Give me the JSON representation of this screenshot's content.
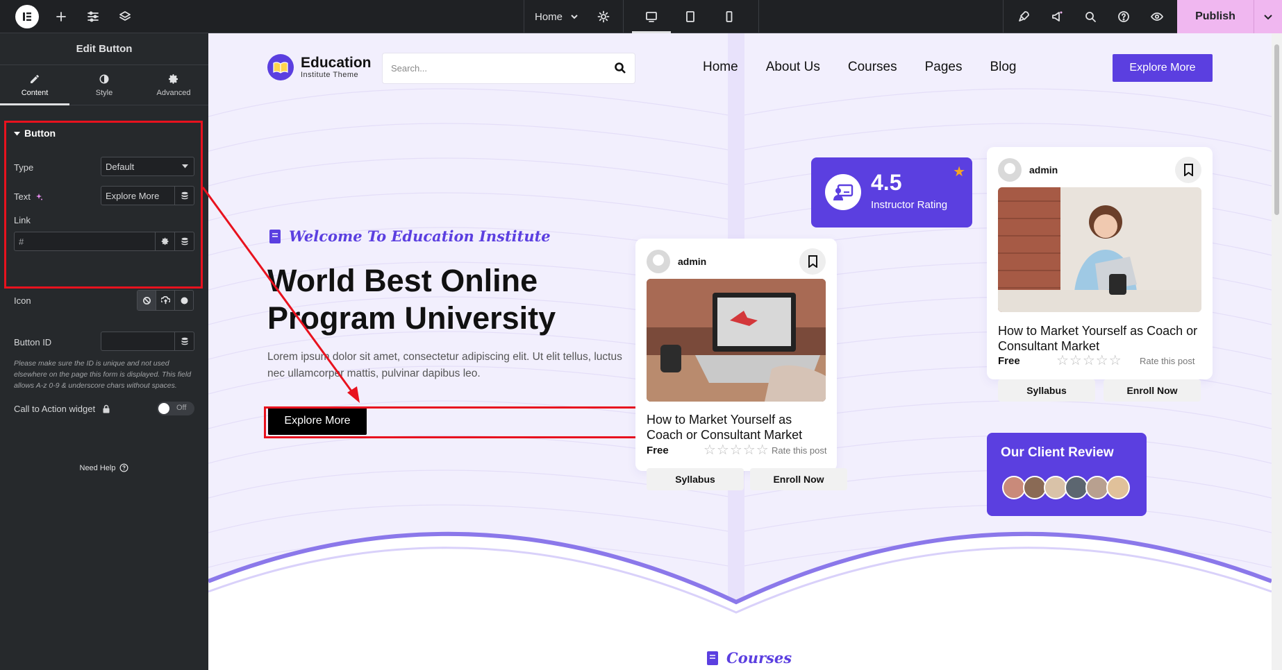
{
  "topbar": {
    "page_name": "Home",
    "publish_label": "Publish"
  },
  "panel": {
    "title": "Edit Button",
    "tabs": [
      {
        "label": "Content"
      },
      {
        "label": "Style"
      },
      {
        "label": "Advanced"
      }
    ],
    "section_title": "Button",
    "type_label": "Type",
    "type_value": "Default",
    "text_label": "Text",
    "text_value": "Explore More",
    "link_label": "Link",
    "link_value": "#",
    "icon_label": "Icon",
    "button_id_label": "Button ID",
    "button_id_value": "",
    "button_id_help": "Please make sure the ID is unique and not used elsewhere on the page this form is displayed. This field allows A-z  0-9 & underscore chars without spaces.",
    "cta_label": "Call to Action widget",
    "toggle_state": "Off",
    "need_help": "Need Help"
  },
  "site": {
    "logo_name": "Education",
    "logo_tagline": "Institute Theme",
    "search_placeholder": "Search...",
    "nav": [
      "Home",
      "About Us",
      "Courses",
      "Pages",
      "Blog"
    ],
    "nav_cta": "Explore More",
    "welcome": "Welcome To Education Institute",
    "hero_title_line1": "World Best Online",
    "hero_title_line2": "Program University",
    "hero_desc": "Lorem ipsum dolor sit amet, consectetur adipiscing elit. Ut elit tellus, luctus nec ullamcorper mattis, pulvinar dapibus leo.",
    "hero_button": "Explore More",
    "rating_value": "4.5",
    "rating_label": "Instructor Rating",
    "cards": [
      {
        "author": "admin",
        "title": "How to Market Yourself as Coach or Consultant Market",
        "price": "Free",
        "stars": "☆☆☆☆☆",
        "rate_text": "Rate this post",
        "btn1": "Syllabus",
        "btn2": "Enroll Now"
      },
      {
        "author": "admin",
        "title": "How to Market Yourself as Coach or Consultant Market",
        "price": "Free",
        "stars": "☆☆☆☆☆",
        "rate_text": "Rate this post",
        "btn1": "Syllabus",
        "btn2": "Enroll Now"
      }
    ],
    "review_title": "Our Client Review",
    "courses_label": "Courses"
  },
  "colors": {
    "accent": "#5b3fe0",
    "panel_bg": "#26292c",
    "topbar_bg": "#1f2124",
    "publish_bg": "#f0b7f0",
    "highlight": "#e8121e",
    "canvas_bg": "#f2effd"
  }
}
